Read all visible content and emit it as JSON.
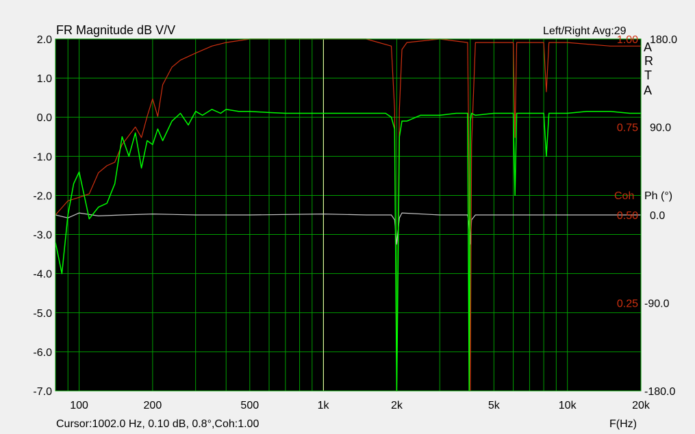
{
  "header": {
    "title": "FR Magnitude dB V/V",
    "top_right": "Left/Right  Avg:29",
    "brand_letters": [
      "A",
      "R",
      "T",
      "A"
    ],
    "coh_label": "Coh",
    "phase_label": "Ph (°)"
  },
  "footer": {
    "cursor": "Cursor:1002.0 Hz, 0.10 dB, 0.8°,Coh:1.00",
    "xlabel": "F(Hz)"
  },
  "colors": {
    "background": "#000000",
    "grid": "#00a000",
    "magnitude": "#00ff00",
    "coherence": "#d03010",
    "phase": "#c8c8c8",
    "cursor": "#ffffb0"
  },
  "chart_data": {
    "type": "line",
    "title": "FR Magnitude dB V/V",
    "xlabel": "F(Hz)",
    "ylabel": "",
    "x_scale": "log",
    "xlim": [
      80,
      20000
    ],
    "ylim": [
      -7,
      2
    ],
    "grid": true,
    "x_tick_labels": [
      "100",
      "200",
      "500",
      "1k",
      "2k",
      "5k",
      "10k",
      "20k"
    ],
    "x_tick_values": [
      100,
      200,
      500,
      1000,
      2000,
      5000,
      10000,
      20000
    ],
    "y_tick_labels": [
      "2.0",
      "1.0",
      "0.0",
      "-1.0",
      "-2.0",
      "-3.0",
      "-4.0",
      "-5.0",
      "-6.0",
      "-7.0"
    ],
    "coh_axis": {
      "label": "Coh",
      "ticks": [
        "1.00",
        "0.75",
        "0.50",
        "0.25"
      ],
      "values": [
        1.0,
        0.75,
        0.5,
        0.25
      ],
      "lim": [
        0,
        1
      ]
    },
    "phase_axis": {
      "label": "Ph (°)",
      "ticks": [
        "180.0",
        "90.0",
        "0.0",
        "-90.0",
        "-180.0"
      ],
      "values": [
        180,
        90,
        0,
        -90,
        -180
      ],
      "lim": [
        -180,
        180
      ]
    },
    "cursor_freq": 1002.0,
    "series": [
      {
        "axis": "left",
        "x": [
          80,
          85,
          90,
          95,
          100,
          110,
          120,
          130,
          140,
          150,
          160,
          170,
          180,
          190,
          200,
          210,
          220,
          240,
          260,
          280,
          300,
          320,
          350,
          380,
          400,
          450,
          500,
          600,
          700,
          800,
          1000,
          1200,
          1500,
          1800,
          1900,
          1960,
          2000,
          2050,
          2100,
          2200,
          2500,
          3000,
          3500,
          3900,
          3960,
          4000,
          4050,
          4200,
          5000,
          6000,
          6100,
          6200,
          7000,
          8000,
          8200,
          8400,
          10000,
          12000,
          15000,
          18000,
          20000
        ],
        "y": [
          -3.2,
          -4.0,
          -2.5,
          -1.7,
          -1.4,
          -2.6,
          -2.3,
          -2.2,
          -1.7,
          -0.5,
          -1.0,
          -0.4,
          -1.3,
          -0.6,
          -0.7,
          -0.3,
          -0.6,
          -0.1,
          0.1,
          -0.2,
          0.15,
          0.05,
          0.2,
          0.1,
          0.2,
          0.15,
          0.15,
          0.12,
          0.1,
          0.1,
          0.1,
          0.1,
          0.1,
          0.1,
          0.0,
          -0.3,
          -7.0,
          -0.5,
          -0.1,
          -0.1,
          0.05,
          0.05,
          0.1,
          0.1,
          -7.0,
          -0.1,
          0.1,
          0.05,
          0.1,
          0.1,
          -2.0,
          0.1,
          0.1,
          0.1,
          -1.0,
          0.1,
          0.1,
          0.15,
          0.15,
          0.1,
          0.1
        ]
      },
      {
        "axis": "coh",
        "x": [
          80,
          90,
          100,
          110,
          120,
          130,
          140,
          150,
          170,
          180,
          190,
          200,
          210,
          220,
          240,
          260,
          300,
          350,
          400,
          500,
          700,
          1000,
          1500,
          1900,
          1960,
          2000,
          2050,
          2100,
          2200,
          3000,
          3900,
          3960,
          4000,
          4050,
          4200,
          6000,
          6100,
          6200,
          8000,
          8200,
          8400,
          10000,
          15000,
          20000
        ],
        "y": [
          0.5,
          0.54,
          0.55,
          0.56,
          0.62,
          0.64,
          0.65,
          0.7,
          0.75,
          0.72,
          0.78,
          0.83,
          0.78,
          0.87,
          0.92,
          0.94,
          0.96,
          0.98,
          0.99,
          1.0,
          1.0,
          1.0,
          1.0,
          0.98,
          0.8,
          0.0,
          0.8,
          0.97,
          0.99,
          1.0,
          0.99,
          0.6,
          0.0,
          0.7,
          0.99,
          0.99,
          0.72,
          0.99,
          0.99,
          0.85,
          0.99,
          0.99,
          0.98,
          0.98
        ]
      },
      {
        "axis": "phase",
        "x": [
          80,
          90,
          100,
          120,
          150,
          200,
          300,
          500,
          1000,
          1500,
          1900,
          1960,
          2000,
          2050,
          2100,
          3000,
          3900,
          3960,
          4000,
          4050,
          4200,
          10000,
          20000
        ],
        "y": [
          0,
          -3,
          2,
          -1,
          0,
          1,
          0,
          0,
          1,
          0,
          0,
          -5,
          -30,
          -3,
          2,
          0,
          0,
          -10,
          -30,
          -5,
          0,
          0,
          0
        ]
      }
    ]
  }
}
